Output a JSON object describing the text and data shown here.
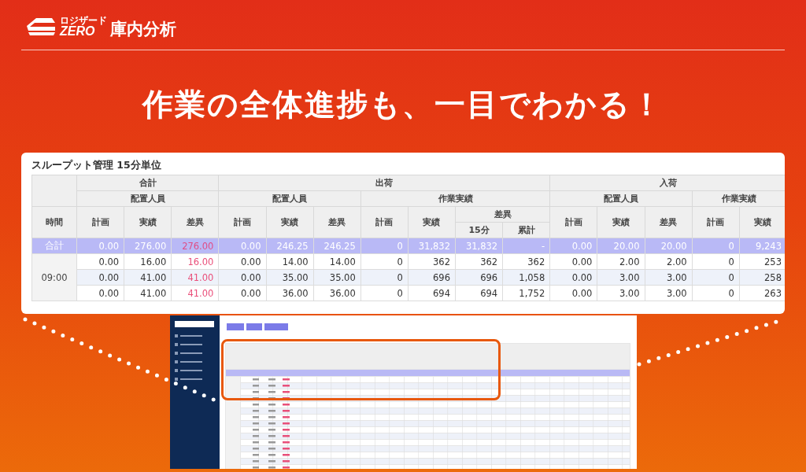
{
  "header": {
    "logo": {
      "brand_small": "ロジザード",
      "brand": "ZERO",
      "product": "庫内分析"
    }
  },
  "headline": "作業の全体進捗も、一目でわかる！",
  "card": {
    "title": "スループット管理 15分単位",
    "table": {
      "corner_label": "時間",
      "columns": [
        {
          "label": "合計",
          "children": [
            {
              "label": "配置人員",
              "children": [
                {
                  "label": "計画",
                  "alert": false
                },
                {
                  "label": "実績",
                  "alert": false
                },
                {
                  "label": "差異",
                  "alert": true
                }
              ]
            }
          ]
        },
        {
          "label": "出荷",
          "children": [
            {
              "label": "配置人員",
              "children": [
                {
                  "label": "計画",
                  "alert": false
                },
                {
                  "label": "実績",
                  "alert": false
                },
                {
                  "label": "差異",
                  "alert": false
                }
              ]
            },
            {
              "label": "作業実績",
              "children": [
                {
                  "label": "計画",
                  "alert": false
                },
                {
                  "label": "実績",
                  "alert": false
                },
                {
                  "label": "差異",
                  "children": [
                    {
                      "label": "15分",
                      "alert": false
                    },
                    {
                      "label": "累計",
                      "alert": false
                    }
                  ]
                }
              ]
            }
          ]
        },
        {
          "label": "入荷",
          "children": [
            {
              "label": "配置人員",
              "children": [
                {
                  "label": "計画",
                  "alert": false
                },
                {
                  "label": "実績",
                  "alert": false
                },
                {
                  "label": "差異",
                  "alert": false
                }
              ]
            },
            {
              "label": "作業実績",
              "children": [
                {
                  "label": "計画",
                  "alert": false
                },
                {
                  "label": "実績",
                  "alert": false
                }
              ]
            }
          ]
        }
      ],
      "total": {
        "label": "合計",
        "cells": [
          "0.00",
          "276.00",
          "276.00",
          "0.00",
          "246.25",
          "246.25",
          "0",
          "31,832",
          "31,832",
          "-",
          "0.00",
          "20.00",
          "20.00",
          "0",
          "9,243"
        ]
      },
      "groups": [
        {
          "time": "09:00",
          "rows": [
            [
              "0.00",
              "16.00",
              "16.00",
              "0.00",
              "14.00",
              "14.00",
              "0",
              "362",
              "362",
              "362",
              "0.00",
              "2.00",
              "2.00",
              "0",
              "253"
            ],
            [
              "0.00",
              "41.00",
              "41.00",
              "0.00",
              "35.00",
              "35.00",
              "0",
              "696",
              "696",
              "1,058",
              "0.00",
              "3.00",
              "3.00",
              "0",
              "258"
            ],
            [
              "0.00",
              "41.00",
              "41.00",
              "0.00",
              "36.00",
              "36.00",
              "0",
              "694",
              "694",
              "1,752",
              "0.00",
              "3.00",
              "3.00",
              "0",
              "263"
            ]
          ]
        }
      ]
    }
  }
}
